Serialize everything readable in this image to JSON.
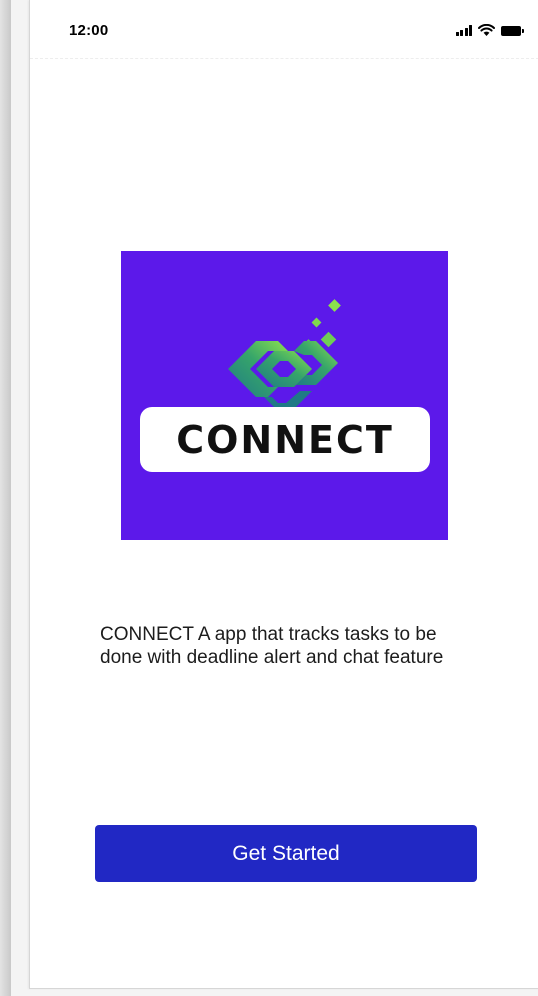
{
  "status_bar": {
    "time": "12:00"
  },
  "logo": {
    "wordmark": "CONNECT",
    "background_color": "#5c19ea"
  },
  "description": "CONNECT A app that tracks tasks to be done with deadline alert and chat feature",
  "cta": {
    "label": "Get Started",
    "color": "#2128c4"
  },
  "icons": {
    "signal": "signal-bars-icon",
    "wifi": "wifi-icon",
    "battery": "battery-icon"
  }
}
